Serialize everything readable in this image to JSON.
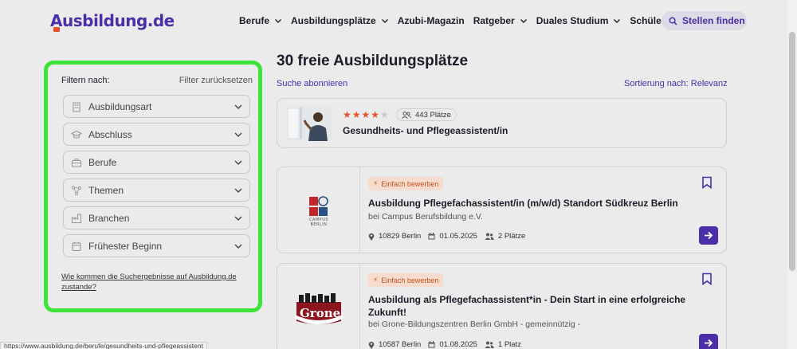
{
  "header": {
    "logo": "Ausbildung.de",
    "nav": [
      {
        "label": "Berufe",
        "dropdown": true
      },
      {
        "label": "Ausbildungsplätze",
        "dropdown": true
      },
      {
        "label": "Azubi-Magazin",
        "dropdown": false
      },
      {
        "label": "Ratgeber",
        "dropdown": true
      },
      {
        "label": "Duales Studium",
        "dropdown": true
      },
      {
        "label": "Schülerpraktikum",
        "dropdown": false
      }
    ],
    "search_button": "Stellen finden"
  },
  "filter": {
    "heading": "Filtern nach:",
    "reset": "Filter zurücksetzen",
    "fields": [
      {
        "label": "Ausbildungsart",
        "icon": "building-icon"
      },
      {
        "label": "Abschluss",
        "icon": "graduation-cap-icon"
      },
      {
        "label": "Berufe",
        "icon": "briefcase-icon"
      },
      {
        "label": "Themen",
        "icon": "topics-icon"
      },
      {
        "label": "Branchen",
        "icon": "industry-icon"
      },
      {
        "label": "Frühester Beginn",
        "icon": "calendar-icon"
      }
    ],
    "info_link": "Wie kommen die Suchergebnisse auf Ausbildung.de zustande?"
  },
  "results": {
    "title": "30 freie Ausbildungsplätze",
    "subscribe": "Suche abonnieren",
    "sort": "Sortierung nach: Relevanz",
    "featured": {
      "rating": 4,
      "rating_max": 5,
      "places": "443 Plätze",
      "title": "Gesundheits- und Pflegeassistent/in"
    },
    "cards": [
      {
        "badge": "Einfach bewerben",
        "title": "Ausbildung Pflegefachassistent/in (m/w/d) Standort Südkreuz Berlin",
        "company": "bei Campus Berufsbildung e.V.",
        "location": "10829 Berlin",
        "date": "01.05.2025",
        "places": "2 Plätze",
        "logo_text": "CAMPUS BERLIN"
      },
      {
        "badge": "Einfach bewerben",
        "title": "Ausbildung als Pflegefachassistent*in - Dein Start in eine erfolgreiche Zukunft!",
        "company": "bei Grone-Bildungszentren Berlin GmbH - gemeinnützig -",
        "location": "10587 Berlin",
        "date": "01.08.2025",
        "places": "1 Platz",
        "logo_text": "Grone"
      }
    ]
  },
  "statusbar": "https://www.ausbildung.de/berufe/gesundheits-und-pflegeassistent",
  "colors": {
    "brand": "#4a2fa8",
    "accent": "#e8502a",
    "highlight_border": "#3ee33a",
    "star_filled": "#e8502a",
    "star_empty": "#c8c8c8"
  }
}
